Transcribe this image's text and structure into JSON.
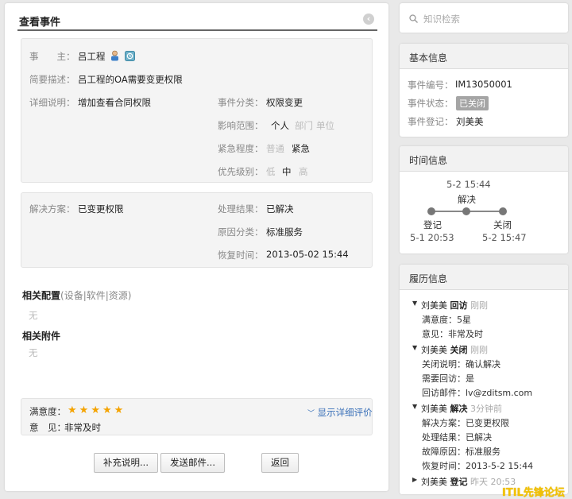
{
  "main": {
    "title": "查看事件",
    "event": {
      "owner_label": "事　　主：",
      "owner": "吕工程",
      "summary_label": "简要描述：",
      "summary": "吕工程的OA需要变更权限",
      "detail_label": "详细说明：",
      "detail": "增加查看合同权限",
      "category_label": "事件分类：",
      "category": "权限变更",
      "scope_label": "影响范围：",
      "scope_options": [
        "个人",
        "部门",
        "单位"
      ],
      "urgency_label": "紧急程度：",
      "urgency_options": [
        "普通",
        "紧急"
      ],
      "priority_label": "优先级别：",
      "priority_options": [
        "低",
        "中",
        "高"
      ]
    },
    "resolution": {
      "solution_label": "解决方案：",
      "solution": "已变更权限",
      "result_label": "处理结果：",
      "result": "已解决",
      "cause_label": "原因分类：",
      "cause": "标准服务",
      "restore_label": "恢复时间：",
      "restore": "2013-05-02 15:44"
    },
    "related_config_title": "相关配置",
    "related_config_sub": "(设备|软件|资源)",
    "related_config_value": "无",
    "attachments_title": "相关附件",
    "attachments_value": "无",
    "rating": {
      "label": "满意度：",
      "stars": 5,
      "opinion_label": "意　见：",
      "opinion": "非常及时",
      "detail_link": "显示详细评价"
    },
    "buttons": {
      "supplement": "补充说明...",
      "send_mail": "发送邮件...",
      "back": "返回"
    }
  },
  "search": {
    "placeholder": "知识检索"
  },
  "basic_info": {
    "title": "基本信息",
    "number_label": "事件编号：",
    "number": "IM13050001",
    "status_label": "事件状态：",
    "status": "已关闭",
    "registrar_label": "事件登记：",
    "registrar": "刘美美"
  },
  "time_info": {
    "title": "时间信息",
    "resolve_time": "5-2 15:44",
    "resolve_label": "解决",
    "register_label": "登记",
    "register_time": "5-1 20:53",
    "close_label": "关闭",
    "close_time": "5-2 15:47"
  },
  "history": {
    "title": "履历信息",
    "entries": [
      {
        "name": "刘美美",
        "action": "回访",
        "time": "刚刚",
        "details": [
          "满意度：5星",
          "意见：非常及时"
        ]
      },
      {
        "name": "刘美美",
        "action": "关闭",
        "time": "刚刚",
        "details": [
          "关闭说明：确认解决",
          "需要回访：是",
          "回访邮件：lv@zditsm.com"
        ]
      },
      {
        "name": "刘美美",
        "action": "解决",
        "time": "3分钟前",
        "details": [
          "解决方案：已变更权限",
          "处理结果：已解决",
          "故障原因：标准服务",
          "恢复时间：2013-5-2 15:44"
        ]
      },
      {
        "name": "刘美美",
        "action": "登记",
        "time": "昨天 20:53",
        "details": []
      }
    ]
  },
  "watermark": "ITIL先锋论坛",
  "colors": {
    "star": "#f4a300",
    "link": "#3a70b8",
    "badge": "#a5a5a5",
    "watermark": "#f3c200"
  }
}
